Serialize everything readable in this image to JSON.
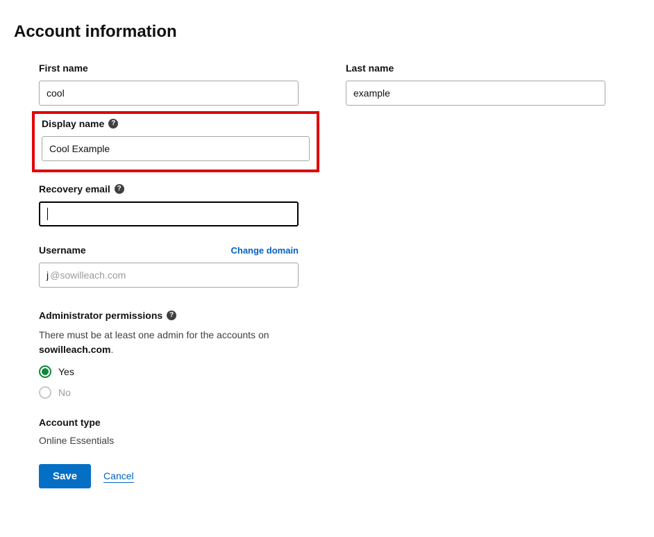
{
  "page_title": "Account information",
  "first_name": {
    "label": "First name",
    "value": "cool"
  },
  "last_name": {
    "label": "Last name",
    "value": "example"
  },
  "display_name": {
    "label": "Display name",
    "value": "Cool Example"
  },
  "recovery_email": {
    "label": "Recovery email",
    "value": ""
  },
  "username": {
    "label": "Username",
    "change_link": "Change domain",
    "value": "j",
    "domain": "@sowilleach.com"
  },
  "admin": {
    "label": "Administrator permissions",
    "desc_prefix": "There must be at least one admin for the accounts on ",
    "domain": "sowilleach.com",
    "desc_suffix": ".",
    "options": {
      "yes": "Yes",
      "no": "No"
    },
    "selected": "yes"
  },
  "account_type": {
    "label": "Account type",
    "value": "Online Essentials"
  },
  "actions": {
    "save": "Save",
    "cancel": "Cancel"
  }
}
